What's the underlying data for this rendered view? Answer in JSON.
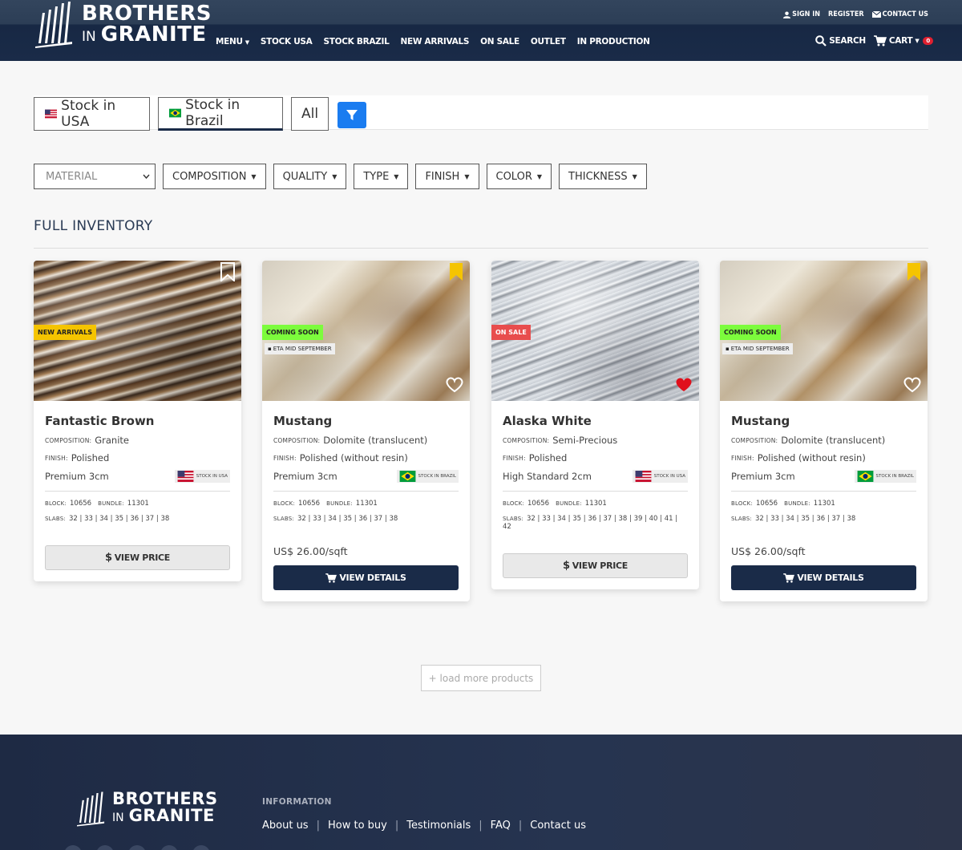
{
  "brand": {
    "line1": "BROTHERS",
    "in": "IN",
    "line2": "GRANITE"
  },
  "utility": {
    "sign_in": "SIGN IN",
    "register": "REGISTER",
    "contact": "CONTACT US"
  },
  "nav": {
    "menu": "MENU",
    "items": [
      "STOCK USA",
      "STOCK BRAZIL",
      "NEW ARRIVALS",
      "ON SALE",
      "OUTLET",
      "IN PRODUCTION"
    ]
  },
  "tools": {
    "search": "SEARCH",
    "cart": "CART",
    "cart_count": "0"
  },
  "stock_tabs": {
    "usa": "Stock in USA",
    "brazil": "Stock in Brazil",
    "all": "All"
  },
  "filters": {
    "material_placeholder": "MATERIAL",
    "dropdowns": [
      "COMPOSITION",
      "QUALITY",
      "TYPE",
      "FINISH",
      "COLOR",
      "THICKNESS"
    ]
  },
  "section_title": "FULL INVENTORY",
  "labels": {
    "composition": "COMPOSITION:",
    "finish": "FINISH:",
    "block": "BLOCK:",
    "bundle": "BUNDLE:",
    "slabs": "SLABS:"
  },
  "products": [
    {
      "name": "Fantastic Brown",
      "composition": "Granite",
      "finish": "Polished",
      "quality": "Premium 3cm",
      "stock": "STOCK IN USA",
      "block": "10656",
      "bundle": "11301",
      "slabs": "32 | 33 | 34 | 35 | 36 | 37 | 38",
      "badge": "NEW ARRIVALS",
      "button": "VIEW PRICE",
      "bookmarked": false,
      "favorited": false
    },
    {
      "name": "Mustang",
      "composition": "Dolomite (translucent)",
      "finish": "Polished (without resin)",
      "quality": "Premium 3cm",
      "stock": "STOCK IN BRAZIL",
      "block": "10656",
      "bundle": "11301",
      "slabs": "32 | 33 | 34 | 35 | 36 | 37 | 38",
      "badge": "COMING SOON",
      "eta": "ETA MID SEPTEMBER",
      "price": "US$ 26.00/sqft",
      "button": "VIEW DETAILS",
      "bookmarked": true,
      "favorited": false
    },
    {
      "name": "Alaska White",
      "composition": "Semi-Precious",
      "finish": "Polished",
      "quality": "High Standard 2cm",
      "stock": "STOCK IN USA",
      "block": "10656",
      "bundle": "11301",
      "slabs": "32 | 33 | 34 | 35 | 36 | 37 | 38 | 39 | 40 | 41 | 42",
      "badge": "ON SALE",
      "button": "VIEW PRICE",
      "bookmarked": false,
      "favorited": true
    },
    {
      "name": "Mustang",
      "composition": "Dolomite (translucent)",
      "finish": "Polished (without resin)",
      "quality": "Premium 3cm",
      "stock": "STOCK IN BRAZIL",
      "block": "10656",
      "bundle": "11301",
      "slabs": "32 | 33 | 34 | 35 | 36 | 37 | 38",
      "badge": "COMING SOON",
      "eta": "ETA MID SEPTEMBER",
      "price": "US$ 26.00/sqft",
      "button": "VIEW DETAILS",
      "bookmarked": true,
      "favorited": false
    }
  ],
  "load_more": "+ load more products",
  "footer": {
    "heading": "INFORMATION",
    "links": [
      "About us",
      "How to buy",
      "Testimonials",
      "FAQ",
      "Contact us"
    ]
  },
  "colors": {
    "navy": "#1a2b48",
    "accent_blue": "#1a7cf0",
    "new_badge": "#f5c400",
    "soon_badge": "#7cfc3c",
    "sale_badge": "#e84d4d",
    "heart_red": "#e0101c",
    "bookmark_gold": "#f5c400"
  }
}
